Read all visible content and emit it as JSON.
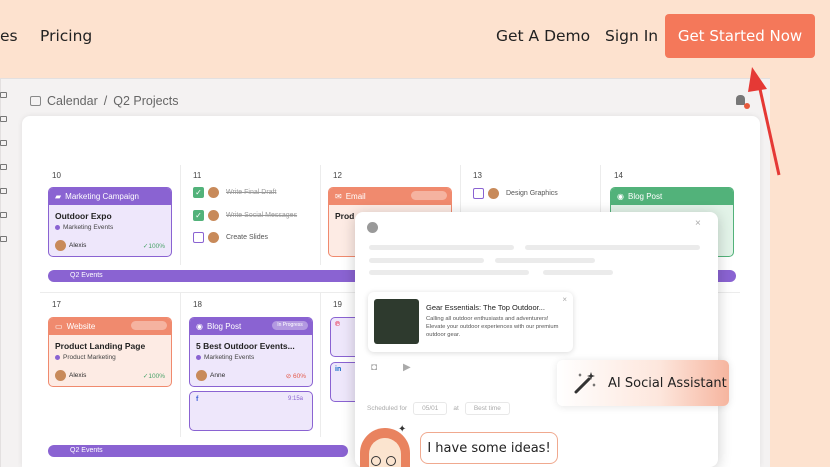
{
  "nav": {
    "partial_left": "es",
    "pricing": "Pricing",
    "demo": "Get A Demo",
    "signin": "Sign In",
    "cta": "Get Started Now"
  },
  "breadcrumb": {
    "first": "Calendar",
    "sep": "/",
    "second": "Q2 Projects"
  },
  "days": {
    "d10": "10",
    "d11": "11",
    "d12": "12",
    "d13": "13",
    "d14": "14",
    "d17": "17",
    "d18": "18",
    "d19": "19"
  },
  "cards": {
    "marketing": {
      "header": "Marketing Campaign",
      "title": "Outdoor Expo",
      "tag": "Marketing Events",
      "user": "Alexis",
      "pct": "✓100%"
    },
    "email": {
      "header": "Email",
      "title": "Prod"
    },
    "blog14": {
      "header": "Blog Post"
    },
    "website": {
      "header": "Website",
      "title": "Product Landing Page",
      "tag": "Product Marketing",
      "user": "Alexis",
      "pct": "✓100%"
    },
    "blog18": {
      "header": "Blog Post",
      "pill": "In Progress",
      "title": "5 Best Outdoor Events...",
      "tag": "Marketing Events",
      "user": "Anne",
      "pct": "⊘ 60%"
    }
  },
  "tasks": [
    {
      "label": "Write Final Draft",
      "done": true
    },
    {
      "label": "Write Social Messages",
      "done": true
    },
    {
      "label": "Create Slides",
      "done": false
    }
  ],
  "task13": "Design Graphics",
  "events": {
    "bar1": "Q2 Events",
    "bar2": "Q2 Events"
  },
  "small": {
    "time": "9:15a"
  },
  "post": {
    "title": "Gear Essentials: The Top Outdoor...",
    "desc": "Calling all outdoor enthusiasts and adventurers! Elevate your outdoor experiences with our premium outdoor gear."
  },
  "schedule": {
    "label": "Scheduled for",
    "date": "05/01",
    "at": "at",
    "time": "Best time"
  },
  "assistant": {
    "label": "AI Social Assistant"
  },
  "chat": {
    "message": "I have some ideas!"
  },
  "colors": {
    "cta": "#f4785a",
    "purple": "#8a63d2",
    "orange": "#f08a6e",
    "green": "#52b27a",
    "arrow": "#e53935",
    "background": "#fde2cf"
  }
}
